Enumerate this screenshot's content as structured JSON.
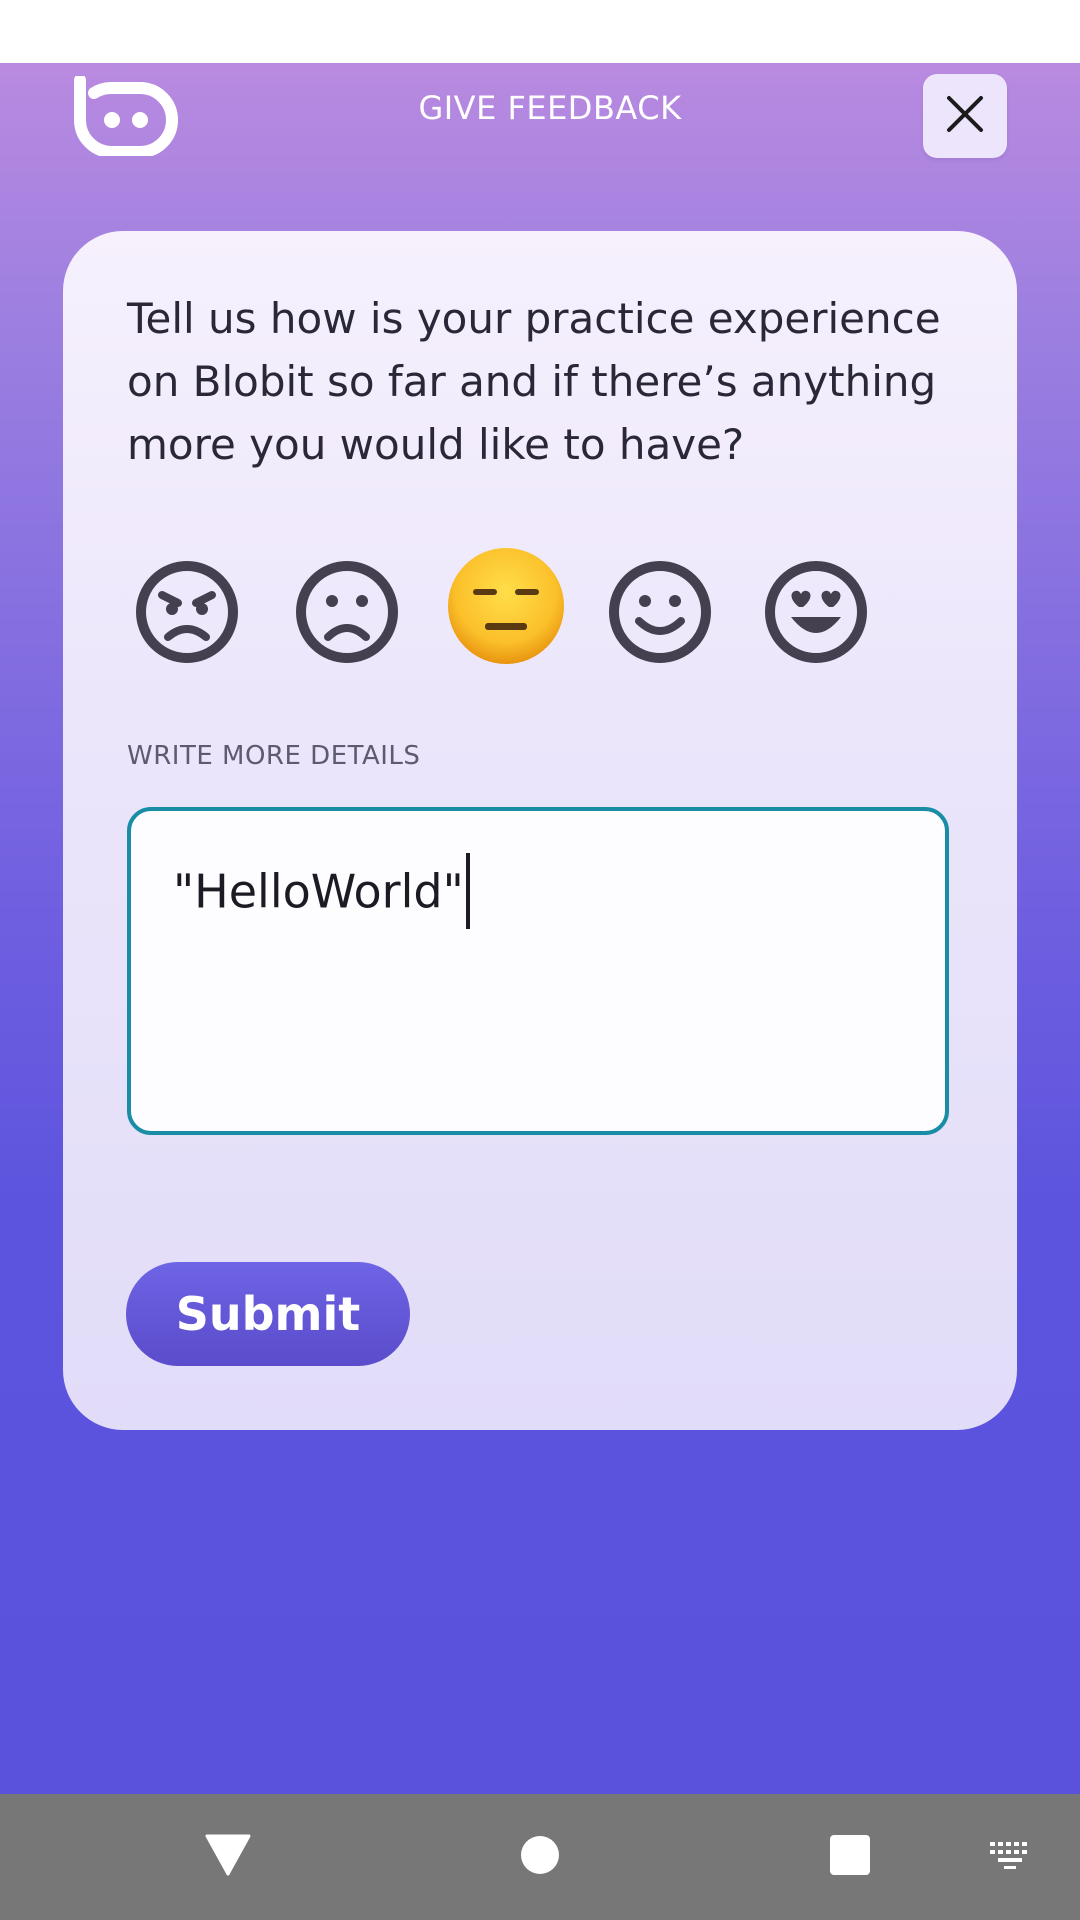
{
  "header": {
    "title": "GIVE FEEDBACK",
    "logo_icon": "blobit-logo-icon",
    "close_icon": "close-icon"
  },
  "card": {
    "question": "Tell us how is your practice experience on Blobit so far and if there’s anything more you would like to have?",
    "ratings": [
      {
        "icon": "angry-face-icon",
        "selected": false
      },
      {
        "icon": "sad-face-icon",
        "selected": false
      },
      {
        "icon": "neutral-face-icon",
        "selected": true
      },
      {
        "icon": "smiling-face-icon",
        "selected": false
      },
      {
        "icon": "heart-eyes-face-icon",
        "selected": false
      }
    ],
    "details_label": "WRITE MORE DETAILS",
    "details_value": "\"HelloWorld\"",
    "submit_label": "Submit"
  },
  "nav": {
    "back_icon": "back-triangle-icon",
    "home_icon": "home-circle-icon",
    "recents_icon": "recents-square-icon",
    "keyboard_icon": "keyboard-icon"
  },
  "colors": {
    "gradient_top": "#b98ae0",
    "gradient_bottom": "#5a52dc",
    "field_border": "#1a8da6",
    "emoji_yellow": "#f7b51e",
    "outline_face": "#45404f"
  }
}
